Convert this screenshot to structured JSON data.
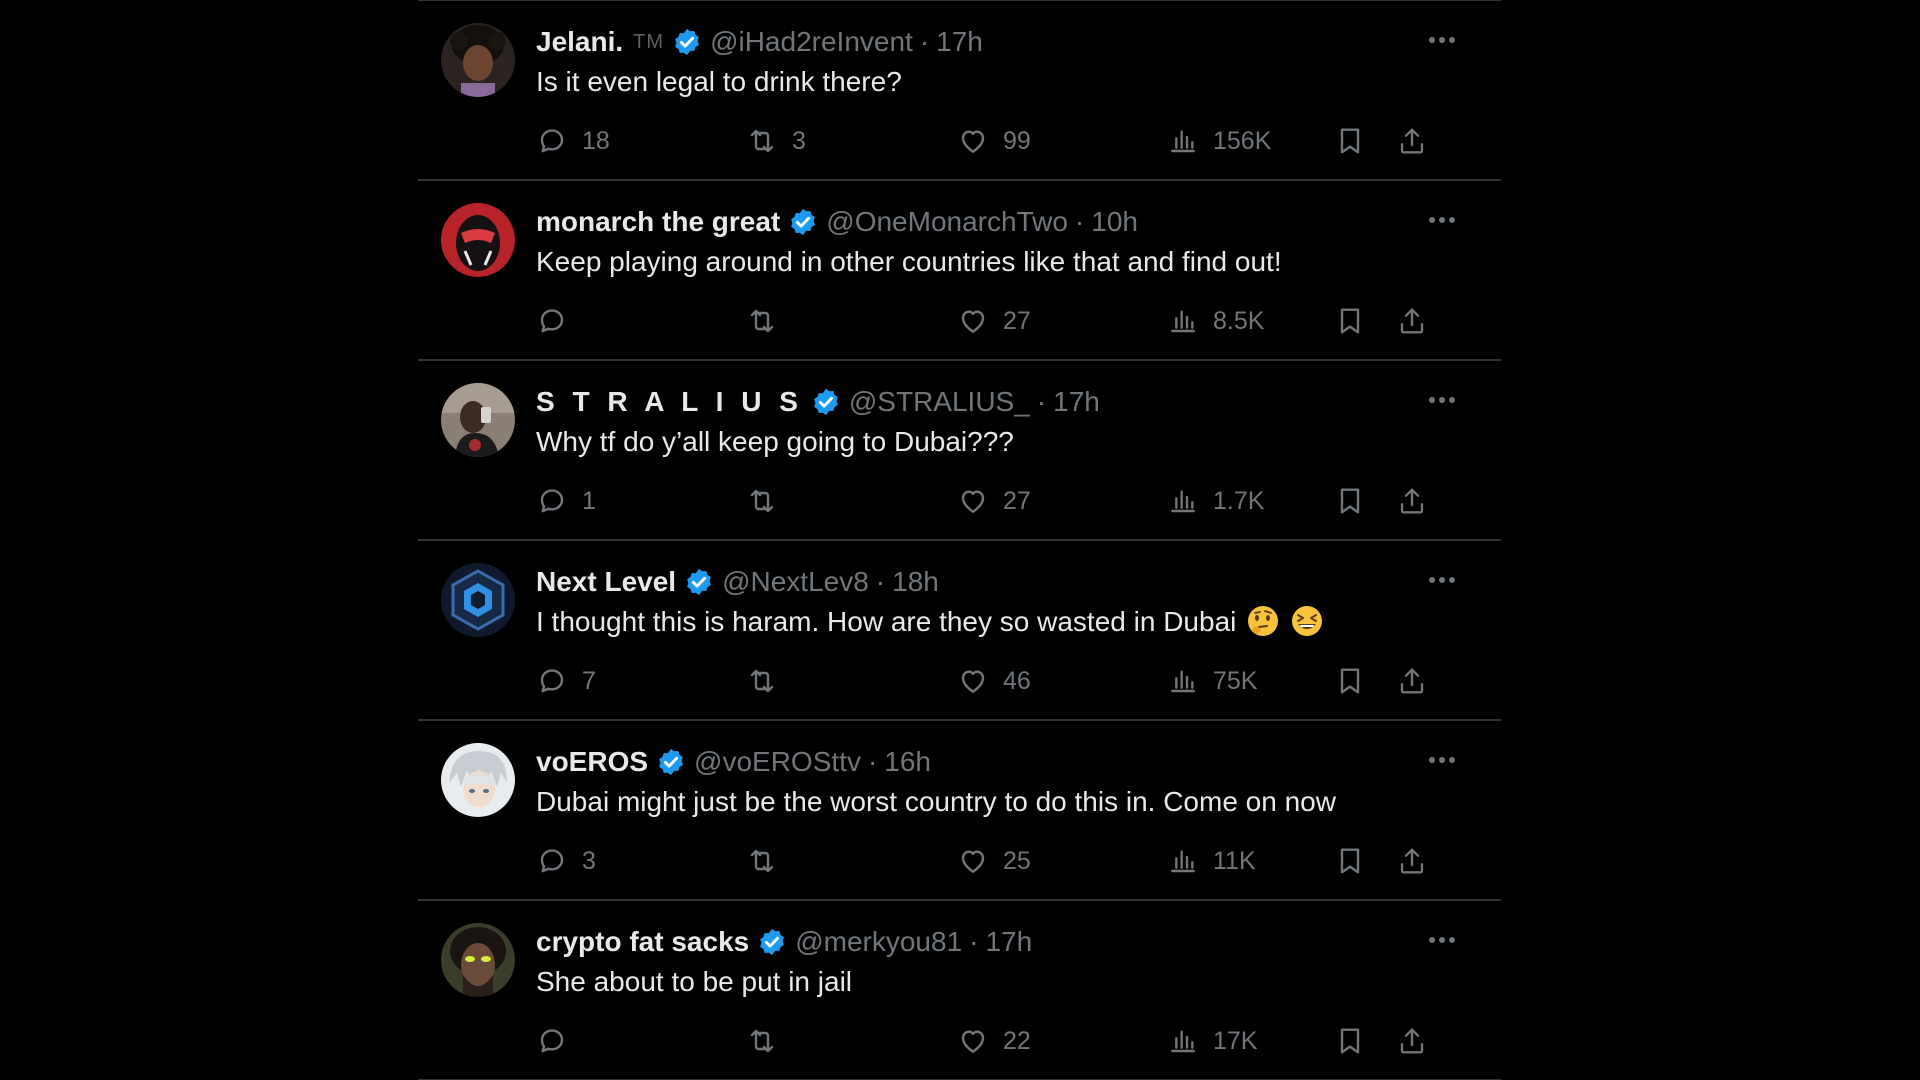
{
  "tweets": [
    {
      "name": "Jelani.",
      "tm": "TM",
      "handle": "@iHad2reInvent",
      "sep": "·",
      "time": "17h",
      "text": "Is it even legal to drink there?",
      "replies": "18",
      "retweets": "3",
      "likes": "99",
      "views": "156K",
      "avatar_icon": "avatar-photo-person"
    },
    {
      "name": "monarch the great",
      "handle": "@OneMonarchTwo",
      "sep": "·",
      "time": "10h",
      "text": "Keep playing around in other countries like that and find out!",
      "replies": "",
      "retweets": "",
      "likes": "27",
      "views": "8.5K",
      "avatar_icon": "avatar-red-masked-figure"
    },
    {
      "name": "S T R A L I U S",
      "handle": "@STRALIUS_",
      "sep": "·",
      "time": "17h",
      "text": "Why tf do y’all keep going to Dubai???",
      "replies": "1",
      "retweets": "",
      "likes": "27",
      "views": "1.7K",
      "avatar_icon": "avatar-mirror-selfie"
    },
    {
      "name": "Next Level",
      "handle": "@NextLev8",
      "sep": "·",
      "time": "18h",
      "text": "I thought this is haram. How are they so wasted in Dubai",
      "emojis": [
        "thinking-face-emoji",
        "grinning-squinting-face-emoji"
      ],
      "replies": "7",
      "retweets": "",
      "likes": "46",
      "views": "75K",
      "avatar_icon": "avatar-hexagon-logo"
    },
    {
      "name": "voEROS",
      "handle": "@voEROSttv",
      "sep": "·",
      "time": "16h",
      "text": "Dubai might just be the worst country to do this in. Come on now",
      "replies": "3",
      "retweets": "",
      "likes": "25",
      "views": "11K",
      "avatar_icon": "avatar-anime-white-hair"
    },
    {
      "name": "crypto fat sacks",
      "handle": "@merkyou81",
      "sep": "·",
      "time": "17h",
      "text": "She about to be put in jail",
      "replies": "",
      "retweets": "",
      "likes": "22",
      "views": "17K",
      "avatar_icon": "avatar-glowing-eyes"
    }
  ],
  "icons": {
    "verified": "verified-badge-icon",
    "more": "more-options-icon",
    "reply": "reply-icon",
    "retweet": "retweet-icon",
    "like": "heart-icon",
    "views": "views-chart-icon",
    "bookmark": "bookmark-icon",
    "share": "share-icon"
  },
  "colors": {
    "background": "#000000",
    "divider": "#2f3336",
    "text": "#e7e9ea",
    "muted": "#71767b",
    "verified": "#1d9bf0"
  }
}
